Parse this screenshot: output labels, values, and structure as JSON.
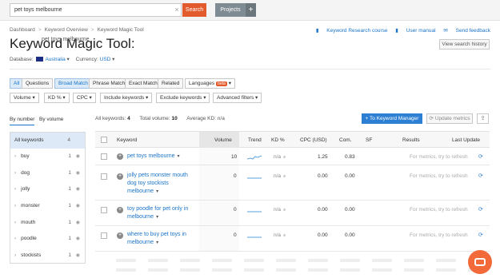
{
  "search": {
    "query": "pet toys melbourne",
    "button": "Search",
    "clear": "×"
  },
  "projects": {
    "label": "Projects",
    "plus": "+"
  },
  "breadcrumb": [
    "Dashboard",
    "Keyword Overview",
    "Keyword Magic Tool"
  ],
  "toplinks": [
    "Keyword Research course",
    "User manual",
    "Send feedback"
  ],
  "title": {
    "tool": "Keyword Magic Tool:",
    "keyword": "pet toys melbourne"
  },
  "view_history": "View search history",
  "database": {
    "label": "Database:",
    "value": "Australia",
    "currency_label": "Currency:",
    "currency": "USD"
  },
  "match_tabs": [
    "All",
    "Questions",
    "Broad Match",
    "Phrase Match",
    "Exact Match",
    "Related"
  ],
  "languages": {
    "label": "Languages",
    "badge": "beta"
  },
  "filters": [
    "Volume",
    "KD %",
    "CPC",
    "Include keywords",
    "Exclude keywords",
    "Advanced filters"
  ],
  "side_tabs": [
    "By number",
    "By volume"
  ],
  "sidebar": {
    "all": {
      "label": "All keywords",
      "count": "4"
    },
    "groups": [
      {
        "label": "buy",
        "count": "1"
      },
      {
        "label": "dog",
        "count": "1"
      },
      {
        "label": "jolly",
        "count": "1"
      },
      {
        "label": "monster",
        "count": "1"
      },
      {
        "label": "mouth",
        "count": "1"
      },
      {
        "label": "poodle",
        "count": "1"
      },
      {
        "label": "stockists",
        "count": "1"
      }
    ]
  },
  "stats": {
    "all_label": "All keywords:",
    "all": "4",
    "vol_label": "Total volume:",
    "vol": "10",
    "kd_label": "Average KD:",
    "kd": "n/a"
  },
  "actions": {
    "to_manager": "+ To Keyword Manager",
    "update": "Update metrics"
  },
  "columns": [
    "Keyword",
    "Volume",
    "Trend",
    "KD %",
    "CPC (USD)",
    "Com.",
    "SF",
    "Results",
    "Last Update"
  ],
  "rows": [
    {
      "keyword": "pet toys melbourne",
      "volume": "10",
      "kd": "n/a",
      "cpc": "1.25",
      "com": "0.83",
      "metrics": "For metrics, try to refresh"
    },
    {
      "keyword": "jolly pets monster mouth dog toy stockists melbourne",
      "volume": "0",
      "kd": "n/a",
      "cpc": "0.00",
      "com": "0.00",
      "metrics": "For metrics, try to refresh"
    },
    {
      "keyword": "toy poodle for pet only in melbourne",
      "volume": "0",
      "kd": "n/a",
      "cpc": "0.00",
      "com": "0.00",
      "metrics": "For metrics, try to refresh"
    },
    {
      "keyword": "where to buy pet toys in melbourne",
      "volume": "0",
      "kd": "n/a",
      "cpc": "0.00",
      "com": "0.00",
      "metrics": "For metrics, try to refresh"
    }
  ],
  "colors": {
    "accent": "#2c7fd3",
    "search": "#e35a2d",
    "chat": "#f36a3a"
  }
}
